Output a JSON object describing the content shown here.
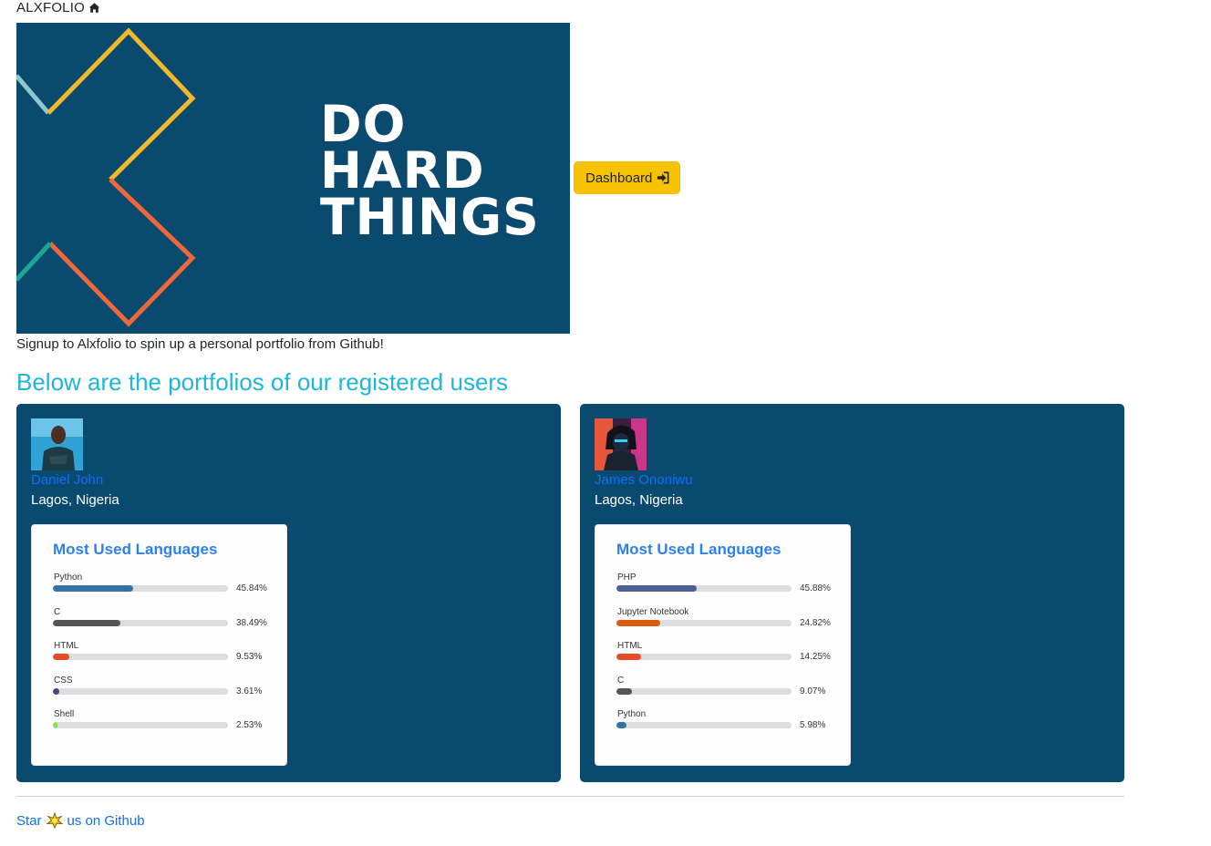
{
  "brand": {
    "title": "ALXFOLIO",
    "icon": "home-icon"
  },
  "hero": {
    "lines": [
      "DO",
      "HARD",
      "THINGS"
    ],
    "background": "#0b4a6f"
  },
  "dashboard_button": {
    "label": "Dashboard",
    "icon": "sign-in-icon",
    "color": "#f7c300"
  },
  "signup_text": "Signup to Alxfolio to spin up a personal portfolio from Github!",
  "section_heading": "Below are the portfolios of our registered users",
  "users": [
    {
      "name": "Daniel John",
      "location": "Lagos, Nigeria",
      "languages_card": {
        "title": "Most Used Languages",
        "languages": [
          {
            "name": "Python",
            "percent_label": "45.84%",
            "percent": 45.84,
            "color": "#3572A5"
          },
          {
            "name": "C",
            "percent_label": "38.49%",
            "percent": 38.49,
            "color": "#555555"
          },
          {
            "name": "HTML",
            "percent_label": "9.53%",
            "percent": 9.53,
            "color": "#e34c26"
          },
          {
            "name": "CSS",
            "percent_label": "3.61%",
            "percent": 3.61,
            "color": "#563d7c"
          },
          {
            "name": "Shell",
            "percent_label": "2.53%",
            "percent": 2.53,
            "color": "#89e051"
          }
        ]
      }
    },
    {
      "name": "James Ononiwu",
      "location": "Lagos, Nigeria",
      "languages_card": {
        "title": "Most Used Languages",
        "languages": [
          {
            "name": "PHP",
            "percent_label": "45.88%",
            "percent": 45.88,
            "color": "#4F5D95"
          },
          {
            "name": "Jupyter Notebook",
            "percent_label": "24.82%",
            "percent": 24.82,
            "color": "#DA5B0B"
          },
          {
            "name": "HTML",
            "percent_label": "14.25%",
            "percent": 14.25,
            "color": "#e34c26"
          },
          {
            "name": "C",
            "percent_label": "9.07%",
            "percent": 9.07,
            "color": "#555555"
          },
          {
            "name": "Python",
            "percent_label": "5.98%",
            "percent": 5.98,
            "color": "#3572A5"
          }
        ]
      }
    }
  ],
  "footer": {
    "prefix": "Star",
    "suffix": "us on Github",
    "icon": "star-icon"
  }
}
